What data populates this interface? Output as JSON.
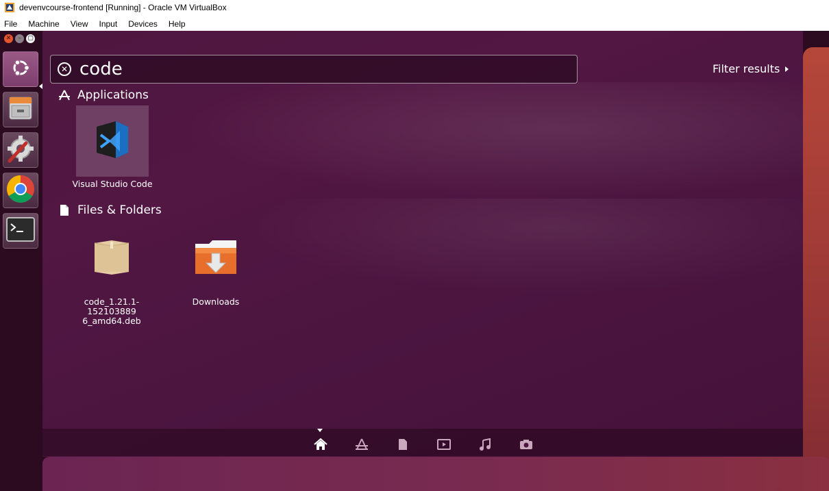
{
  "window": {
    "title": "devenvcourse-frontend [Running] - Oracle VM VirtualBox"
  },
  "menubar": {
    "items": [
      "File",
      "Machine",
      "View",
      "Input",
      "Devices",
      "Help"
    ]
  },
  "launcher": {
    "items": [
      {
        "name": "dash-home",
        "icon": "ubuntu-logo-icon",
        "active": true
      },
      {
        "name": "file-manager",
        "icon": "file-cabinet-icon"
      },
      {
        "name": "system-settings",
        "icon": "settings-gear-wrench-icon"
      },
      {
        "name": "chrome",
        "icon": "chrome-icon"
      },
      {
        "name": "terminal",
        "icon": "terminal-icon"
      }
    ]
  },
  "search": {
    "query": "code"
  },
  "filter": {
    "label": "Filter results"
  },
  "sections": {
    "applications": {
      "title": "Applications",
      "items": [
        {
          "label": "Visual Studio Code",
          "icon": "vscode-icon"
        }
      ]
    },
    "files": {
      "title": "Files & Folders",
      "items": [
        {
          "label_line1": "code_1.21.1-152103889",
          "label_line2": "6_amd64.deb",
          "icon": "package-icon"
        },
        {
          "label": "Downloads",
          "icon": "downloads-folder-icon"
        }
      ]
    }
  },
  "lenses": [
    "home-lens-icon",
    "applications-lens-icon",
    "files-lens-icon",
    "video-lens-icon",
    "music-lens-icon",
    "photos-lens-icon"
  ],
  "colors": {
    "dash_bg": "#4e1740",
    "accent_orange": "#e3572f"
  }
}
